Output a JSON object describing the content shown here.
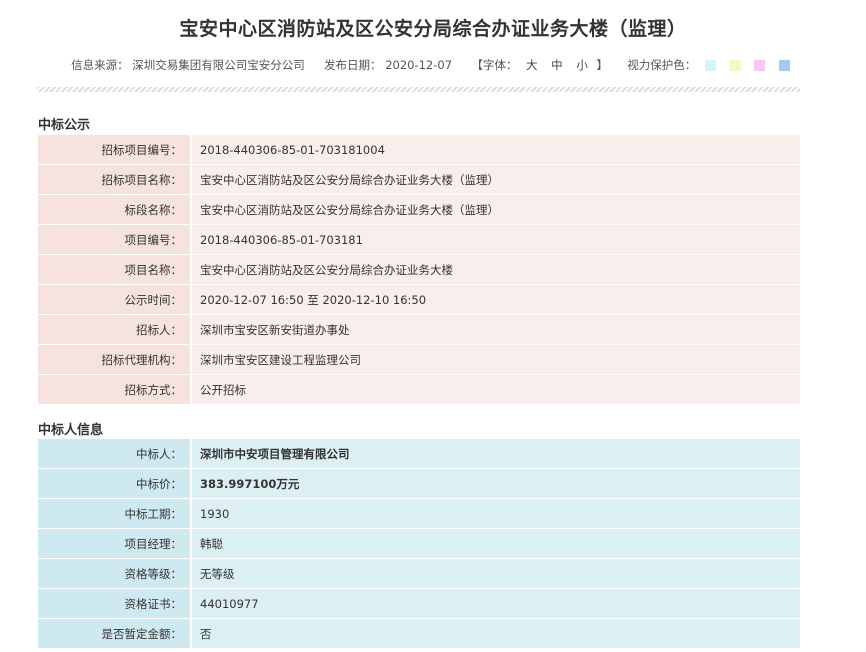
{
  "page": {
    "title": "宝安中心区消防站及区公安分局综合办证业务大楼（监理）"
  },
  "meta": {
    "source_label": "信息来源：",
    "source_value": "深圳交易集团有限公司宝安分公司",
    "date_label": "发布日期：",
    "date_value": "2020-12-07",
    "font_open": "【字体：",
    "font_large": "大",
    "font_medium": "中",
    "font_small": "小",
    "font_close": "】",
    "vision_label": "视力保护色：",
    "swatches": [
      "#d4f6fb",
      "#f6f7c7",
      "#f8c8f4",
      "#a6c9ef"
    ]
  },
  "section1": {
    "title": "中标公示",
    "rows": [
      {
        "label": "招标项目编号：",
        "value": "2018-440306-85-01-703181004"
      },
      {
        "label": "招标项目名称：",
        "value": "宝安中心区消防站及区公安分局综合办证业务大楼（监理）"
      },
      {
        "label": "标段名称：",
        "value": "宝安中心区消防站及区公安分局综合办证业务大楼（监理）"
      },
      {
        "label": "项目编号：",
        "value": "2018-440306-85-01-703181"
      },
      {
        "label": "项目名称：",
        "value": "宝安中心区消防站及区公安分局综合办证业务大楼"
      },
      {
        "label": "公示时间：",
        "value": "2020-12-07 16:50 至 2020-12-10 16:50"
      },
      {
        "label": "招标人：",
        "value": "深圳市宝安区新安街道办事处"
      },
      {
        "label": "招标代理机构：",
        "value": "深圳市宝安区建设工程监理公司"
      },
      {
        "label": "招标方式：",
        "value": "公开招标"
      }
    ]
  },
  "section2": {
    "title": "中标人信息",
    "rows": [
      {
        "label": "中标人：",
        "value": "深圳市中安项目管理有限公司"
      },
      {
        "label": "中标价：",
        "value": "383.997100万元"
      },
      {
        "label": "中标工期：",
        "value": "1930"
      },
      {
        "label": "项目经理：",
        "value": "韩聪"
      },
      {
        "label": "资格等级：",
        "value": "无等级"
      },
      {
        "label": "资格证书：",
        "value": "44010977"
      },
      {
        "label": "是否暂定金额：",
        "value": "否"
      }
    ]
  }
}
